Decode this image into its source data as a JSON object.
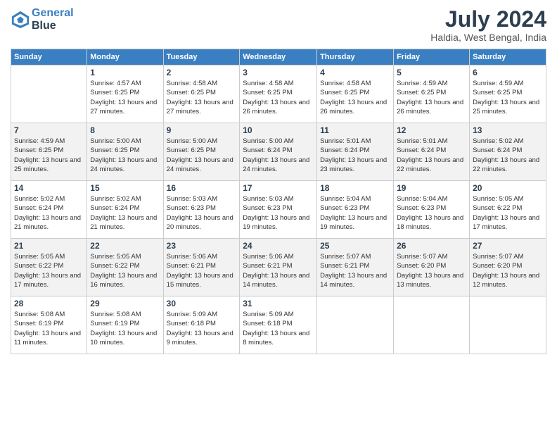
{
  "header": {
    "logo_line1": "General",
    "logo_line2": "Blue",
    "month_year": "July 2024",
    "location": "Haldia, West Bengal, India"
  },
  "weekdays": [
    "Sunday",
    "Monday",
    "Tuesday",
    "Wednesday",
    "Thursday",
    "Friday",
    "Saturday"
  ],
  "weeks": [
    [
      {
        "date": "",
        "sunrise": "",
        "sunset": "",
        "daylight": ""
      },
      {
        "date": "1",
        "sunrise": "Sunrise: 4:57 AM",
        "sunset": "Sunset: 6:25 PM",
        "daylight": "Daylight: 13 hours and 27 minutes."
      },
      {
        "date": "2",
        "sunrise": "Sunrise: 4:58 AM",
        "sunset": "Sunset: 6:25 PM",
        "daylight": "Daylight: 13 hours and 27 minutes."
      },
      {
        "date": "3",
        "sunrise": "Sunrise: 4:58 AM",
        "sunset": "Sunset: 6:25 PM",
        "daylight": "Daylight: 13 hours and 26 minutes."
      },
      {
        "date": "4",
        "sunrise": "Sunrise: 4:58 AM",
        "sunset": "Sunset: 6:25 PM",
        "daylight": "Daylight: 13 hours and 26 minutes."
      },
      {
        "date": "5",
        "sunrise": "Sunrise: 4:59 AM",
        "sunset": "Sunset: 6:25 PM",
        "daylight": "Daylight: 13 hours and 26 minutes."
      },
      {
        "date": "6",
        "sunrise": "Sunrise: 4:59 AM",
        "sunset": "Sunset: 6:25 PM",
        "daylight": "Daylight: 13 hours and 25 minutes."
      }
    ],
    [
      {
        "date": "7",
        "sunrise": "Sunrise: 4:59 AM",
        "sunset": "Sunset: 6:25 PM",
        "daylight": "Daylight: 13 hours and 25 minutes."
      },
      {
        "date": "8",
        "sunrise": "Sunrise: 5:00 AM",
        "sunset": "Sunset: 6:25 PM",
        "daylight": "Daylight: 13 hours and 24 minutes."
      },
      {
        "date": "9",
        "sunrise": "Sunrise: 5:00 AM",
        "sunset": "Sunset: 6:25 PM",
        "daylight": "Daylight: 13 hours and 24 minutes."
      },
      {
        "date": "10",
        "sunrise": "Sunrise: 5:00 AM",
        "sunset": "Sunset: 6:24 PM",
        "daylight": "Daylight: 13 hours and 24 minutes."
      },
      {
        "date": "11",
        "sunrise": "Sunrise: 5:01 AM",
        "sunset": "Sunset: 6:24 PM",
        "daylight": "Daylight: 13 hours and 23 minutes."
      },
      {
        "date": "12",
        "sunrise": "Sunrise: 5:01 AM",
        "sunset": "Sunset: 6:24 PM",
        "daylight": "Daylight: 13 hours and 22 minutes."
      },
      {
        "date": "13",
        "sunrise": "Sunrise: 5:02 AM",
        "sunset": "Sunset: 6:24 PM",
        "daylight": "Daylight: 13 hours and 22 minutes."
      }
    ],
    [
      {
        "date": "14",
        "sunrise": "Sunrise: 5:02 AM",
        "sunset": "Sunset: 6:24 PM",
        "daylight": "Daylight: 13 hours and 21 minutes."
      },
      {
        "date": "15",
        "sunrise": "Sunrise: 5:02 AM",
        "sunset": "Sunset: 6:24 PM",
        "daylight": "Daylight: 13 hours and 21 minutes."
      },
      {
        "date": "16",
        "sunrise": "Sunrise: 5:03 AM",
        "sunset": "Sunset: 6:23 PM",
        "daylight": "Daylight: 13 hours and 20 minutes."
      },
      {
        "date": "17",
        "sunrise": "Sunrise: 5:03 AM",
        "sunset": "Sunset: 6:23 PM",
        "daylight": "Daylight: 13 hours and 19 minutes."
      },
      {
        "date": "18",
        "sunrise": "Sunrise: 5:04 AM",
        "sunset": "Sunset: 6:23 PM",
        "daylight": "Daylight: 13 hours and 19 minutes."
      },
      {
        "date": "19",
        "sunrise": "Sunrise: 5:04 AM",
        "sunset": "Sunset: 6:23 PM",
        "daylight": "Daylight: 13 hours and 18 minutes."
      },
      {
        "date": "20",
        "sunrise": "Sunrise: 5:05 AM",
        "sunset": "Sunset: 6:22 PM",
        "daylight": "Daylight: 13 hours and 17 minutes."
      }
    ],
    [
      {
        "date": "21",
        "sunrise": "Sunrise: 5:05 AM",
        "sunset": "Sunset: 6:22 PM",
        "daylight": "Daylight: 13 hours and 17 minutes."
      },
      {
        "date": "22",
        "sunrise": "Sunrise: 5:05 AM",
        "sunset": "Sunset: 6:22 PM",
        "daylight": "Daylight: 13 hours and 16 minutes."
      },
      {
        "date": "23",
        "sunrise": "Sunrise: 5:06 AM",
        "sunset": "Sunset: 6:21 PM",
        "daylight": "Daylight: 13 hours and 15 minutes."
      },
      {
        "date": "24",
        "sunrise": "Sunrise: 5:06 AM",
        "sunset": "Sunset: 6:21 PM",
        "daylight": "Daylight: 13 hours and 14 minutes."
      },
      {
        "date": "25",
        "sunrise": "Sunrise: 5:07 AM",
        "sunset": "Sunset: 6:21 PM",
        "daylight": "Daylight: 13 hours and 14 minutes."
      },
      {
        "date": "26",
        "sunrise": "Sunrise: 5:07 AM",
        "sunset": "Sunset: 6:20 PM",
        "daylight": "Daylight: 13 hours and 13 minutes."
      },
      {
        "date": "27",
        "sunrise": "Sunrise: 5:07 AM",
        "sunset": "Sunset: 6:20 PM",
        "daylight": "Daylight: 13 hours and 12 minutes."
      }
    ],
    [
      {
        "date": "28",
        "sunrise": "Sunrise: 5:08 AM",
        "sunset": "Sunset: 6:19 PM",
        "daylight": "Daylight: 13 hours and 11 minutes."
      },
      {
        "date": "29",
        "sunrise": "Sunrise: 5:08 AM",
        "sunset": "Sunset: 6:19 PM",
        "daylight": "Daylight: 13 hours and 10 minutes."
      },
      {
        "date": "30",
        "sunrise": "Sunrise: 5:09 AM",
        "sunset": "Sunset: 6:18 PM",
        "daylight": "Daylight: 13 hours and 9 minutes."
      },
      {
        "date": "31",
        "sunrise": "Sunrise: 5:09 AM",
        "sunset": "Sunset: 6:18 PM",
        "daylight": "Daylight: 13 hours and 8 minutes."
      },
      {
        "date": "",
        "sunrise": "",
        "sunset": "",
        "daylight": ""
      },
      {
        "date": "",
        "sunrise": "",
        "sunset": "",
        "daylight": ""
      },
      {
        "date": "",
        "sunrise": "",
        "sunset": "",
        "daylight": ""
      }
    ]
  ]
}
